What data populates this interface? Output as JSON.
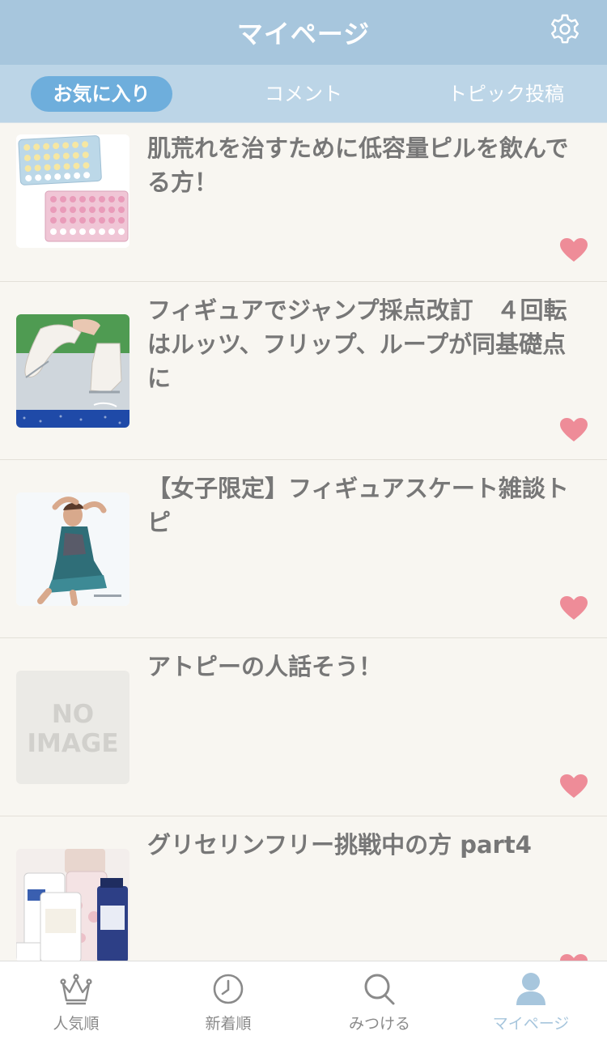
{
  "header": {
    "title": "マイページ"
  },
  "tabs": [
    {
      "label": "お気に入り",
      "active": true
    },
    {
      "label": "コメント",
      "active": false
    },
    {
      "label": "トピック投稿",
      "active": false
    }
  ],
  "items": [
    {
      "title": "肌荒れを治すために低容量ピルを飲んでる方！",
      "thumb": "pill-packs"
    },
    {
      "title": "フィギュアでジャンプ採点改訂　４回転はルッツ、フリップ、ループが同基礎点に",
      "thumb": "skate-boots"
    },
    {
      "title": "【女子限定】フィギュアスケート雑談トピ",
      "thumb": "skater"
    },
    {
      "title": "アトピーの人話そう！",
      "thumb": "no-image"
    },
    {
      "title": "グリセリンフリー挑戦中の方 part4",
      "thumb": "cosmetic-bottles"
    }
  ],
  "no_image_text": [
    "NO",
    "IMAGE"
  ],
  "bottom_nav": [
    {
      "label": "人気順",
      "icon": "crown-icon"
    },
    {
      "label": "新着順",
      "icon": "clock-icon"
    },
    {
      "label": "みつける",
      "icon": "search-icon"
    },
    {
      "label": "マイページ",
      "icon": "person-icon",
      "active": true
    }
  ],
  "colors": {
    "header": "#a7c6dd",
    "tabs_bar": "#bcd5e7",
    "active_tab": "#6eaedc",
    "heart": "#ee8c98",
    "background": "#f8f6f1"
  }
}
